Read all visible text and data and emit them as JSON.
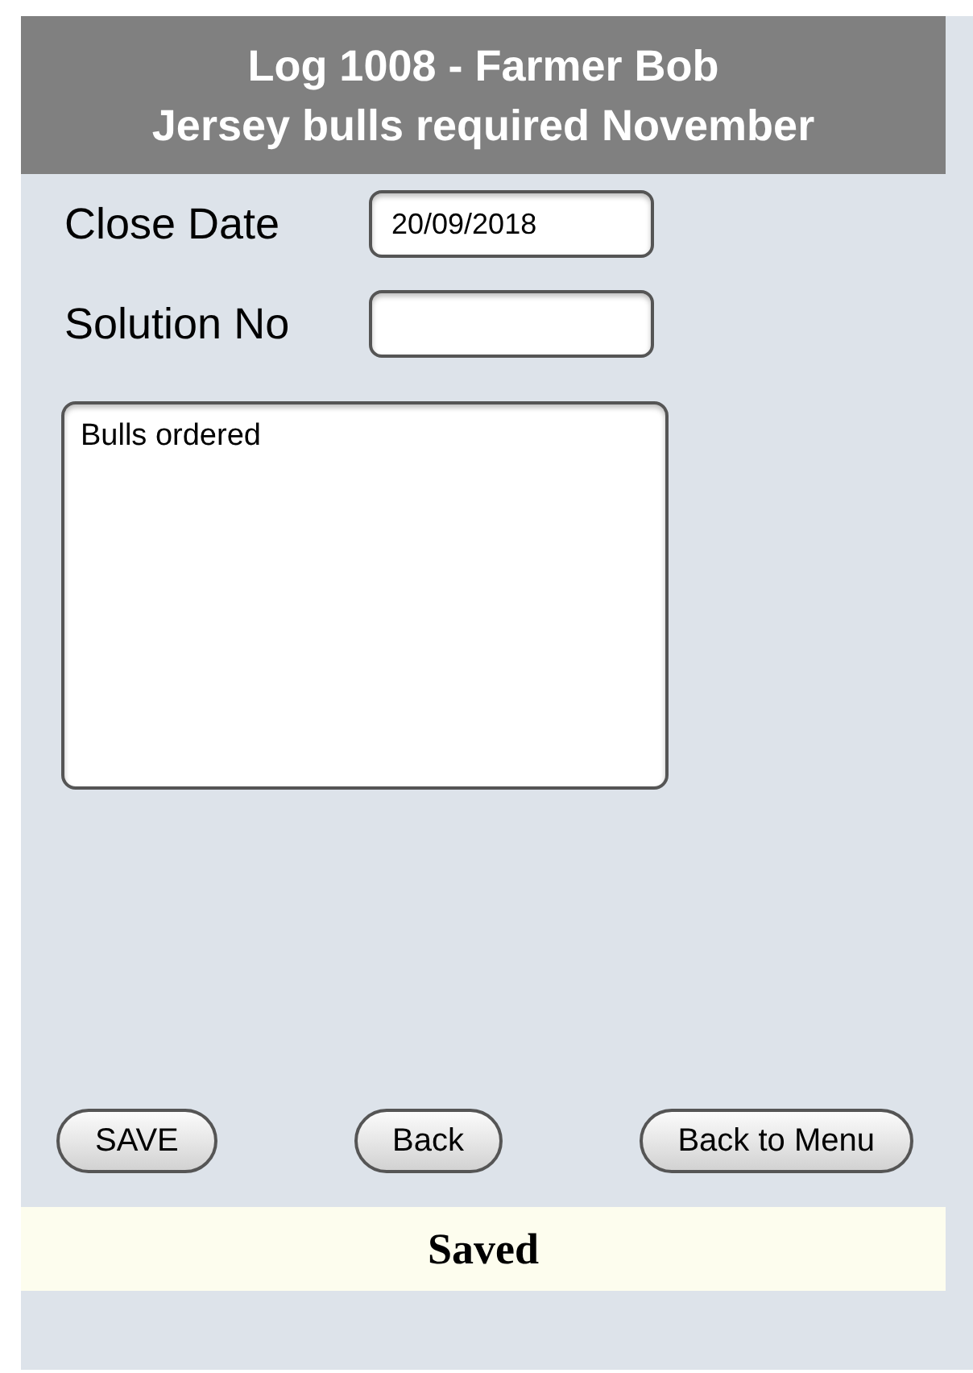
{
  "header": {
    "title": "Log 1008 - Farmer Bob",
    "subtitle": "Jersey bulls required November"
  },
  "fields": [
    {
      "label": "Close Date",
      "value": "20/09/2018"
    },
    {
      "label": "Solution No"
    }
  ],
  "notes": {
    "value": "Bulls ordered"
  },
  "buttons": [
    {
      "label": "SAVE"
    },
    {
      "label": "Back"
    },
    {
      "label": "Back to Menu"
    }
  ],
  "status": "Saved"
}
